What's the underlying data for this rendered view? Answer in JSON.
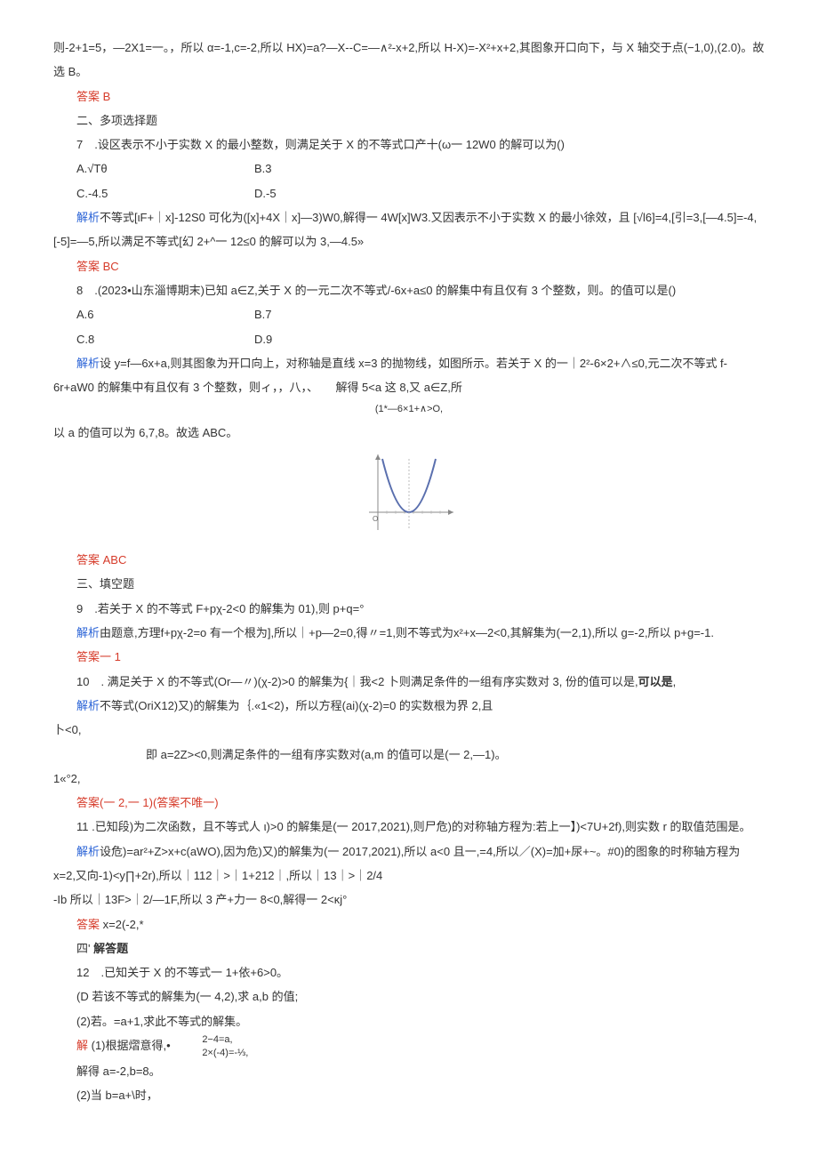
{
  "p1": "则-2+1=5，—2X1=一。，所以 α=-1,c=-2,所以 HX)=a?—X--C=—∧²-x+2,所以 H-X)=-X²+x+2,其图象开口向下，与 X 轴交于点(−1,0),(2.0)。故选 B。",
  "ans6": "答案 B",
  "sec2": "二、多项选择题",
  "q7": "7　.设区表示不小于实数 X 的最小整数，则满足关于 X 的不等式口产十(ω一 12W0 的解可以为()",
  "q7a": "A.√Tθ",
  "q7b": "B.3",
  "q7c": "C.-4.5",
  "q7d": "D.-5",
  "q7ex_lbl": "解析",
  "q7ex": "不等式[ιF+｜x]-12S0 可化为([x]+4X｜x]—3)W0,解得一 4W[x]W3.又因表示不小于实数 X 的最小徐效，且 [√l6]=4,[引=3,[—4.5]=-4,[-5]=—5,所以满足不等式[幻 2+^一 12≤0 的解可以为 3,—4.5»",
  "ans7": "答案 BC",
  "q8": "8　.(2023•山东淄博期末)已知 a∈Z,关于 X 的一元二次不等式/-6x+a≤0 的解集中有且仅有 3 个整数，则。的值可以是()",
  "q8a": "A.6",
  "q8b": "B.7",
  "q8c": "C.8",
  "q8d": "D.9",
  "q8ex_lbl": "解析",
  "q8ex1": "设 y=f—6x+a,则其图象为开口向上，对称轴是直线 x=3 的抛物线，如图所示。若关于 X 的一｜2²-6×2+∧≤0,元二次不等式 f-6r+aW0 的解集中有且仅有 3 个整数，则ィ，，八，、　　解得 5<a 这 8,又 a∈Z,所",
  "q8ex1b": "(1*—6×1+∧>O,",
  "q8ex2": "以 a 的值可以为 6,7,8。故选 ABC。",
  "ans8": "答案 ABC",
  "sec3": "三、填空题",
  "q9": "9　.若关于 X 的不等式 F+pχ-2<0 的解集为 01),则 p+q=°",
  "q9ex_lbl": "解析",
  "q9ex": "由题意,方理f+pχ-2=o 有一个根为],所以｜+p—2=0,得〃=1,则不等式为x²+x—2<0,其解集为(一2,1),所以 g=-2,所以 p+g=-1.",
  "ans9": "答案一 1",
  "q10": "10　. 满足关于 X 的不等式(Or—〃)(χ-2)>0 的解集为{｜我<2 卜则满足条件的一组有序实数对 3, 份的值可以是,",
  "q10ex_lbl": "解析",
  "q10ex": "不等式(OriX12)又)的解集为｛.«1<2)，所以方程(ai)(χ-2)=0 的实数根为界 2,且",
  "q10ex2": "卜<0,",
  "q10ex3": "即 a=2Z><0,则满足条件的一组有序实数对(a,m 的值可以是(一 2,—1)。",
  "q10ex4": "1«°2,",
  "ans10": "答案(一 2,一 1)(答案不唯一)",
  "q11": "11 .已知段)为二次函数，且不等式人 ι)>0 的解集是(一 2017,2021),则尸危)的对称轴方程为:若上一】)<7U+2f),则实数 r 的取值范围是。",
  "q11ex_lbl": "解析",
  "q11ex": "设危)=ar²+Z>x+c(aWO),因为危)又)的解集为(一 2017,2021),所以 a<0 且一,=4,所以／(X)=加+尿+~。#0)的图象的时称轴方程为 x=2,又向-1)<y∏+2r),所以｜112｜>｜1+212｜,所以｜13｜>｜2/4",
  "q11ex2": "-Ib 所以｜13F>｜2/—1F,所以 3 产+力一 8<0,解得一 2<κj°",
  "ans11_lbl": "答案 ",
  "ans11": "x=2(-2,*",
  "sec4a": "四' ",
  "sec4b": "解答题",
  "q12": "12　.已知关于 X 的不等式一 1+依+6>0。",
  "q12_1": "(D 若该不等式的解集为(一 4,2),求 a,b 的值;",
  "q12_2": "(2)若。=a+1,求此不等式的解集。",
  "q12sol_lbl": "解 ",
  "q12sol1a": "(1)根据熠意得,•",
  "q12sol_line1": "2−4=a,",
  "q12sol_line2": "2×(-4)=-⅓,",
  "q12sol2": "解得 a=-2,b=8。",
  "q12sol3": "(2)当 b=a+\\时，"
}
